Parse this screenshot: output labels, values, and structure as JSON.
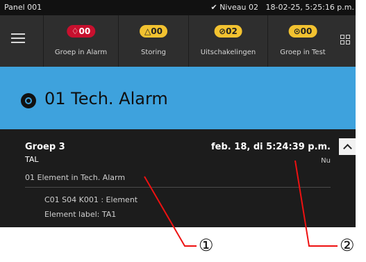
{
  "statusbar": {
    "panel": "Panel 001",
    "level": "Niveau 02",
    "datetime": "18-02-25, 5:25:16 p.m."
  },
  "toolbar": {
    "menu_icon": "hamburger-menu-icon",
    "tiles": [
      {
        "count": "00",
        "label": "Groep in Alarm",
        "icon": "fire-icon",
        "color": "#c8102e"
      },
      {
        "count": "00",
        "label": "Storing",
        "icon": "warning-triangle-icon",
        "color": "#f2c230"
      },
      {
        "count": "02",
        "label": "Uitschakelingen",
        "icon": "disabled-circle-icon",
        "color": "#f2c230"
      },
      {
        "count": "00",
        "label": "Groep in Test",
        "icon": "test-icon",
        "color": "#f2c230"
      }
    ]
  },
  "banner": {
    "title": "01 Tech. Alarm",
    "color": "#3ea2dd"
  },
  "event": {
    "group": "Groep 3",
    "type": "TAL",
    "element": "01 Element in Tech. Alarm",
    "timestamp": "feb. 18, di 5:24:39 p.m.",
    "relative": "Nu",
    "detail_address": "C01 S04 K001 : Element",
    "detail_label": "Element label: TA1"
  },
  "callouts": [
    "①",
    "②"
  ]
}
